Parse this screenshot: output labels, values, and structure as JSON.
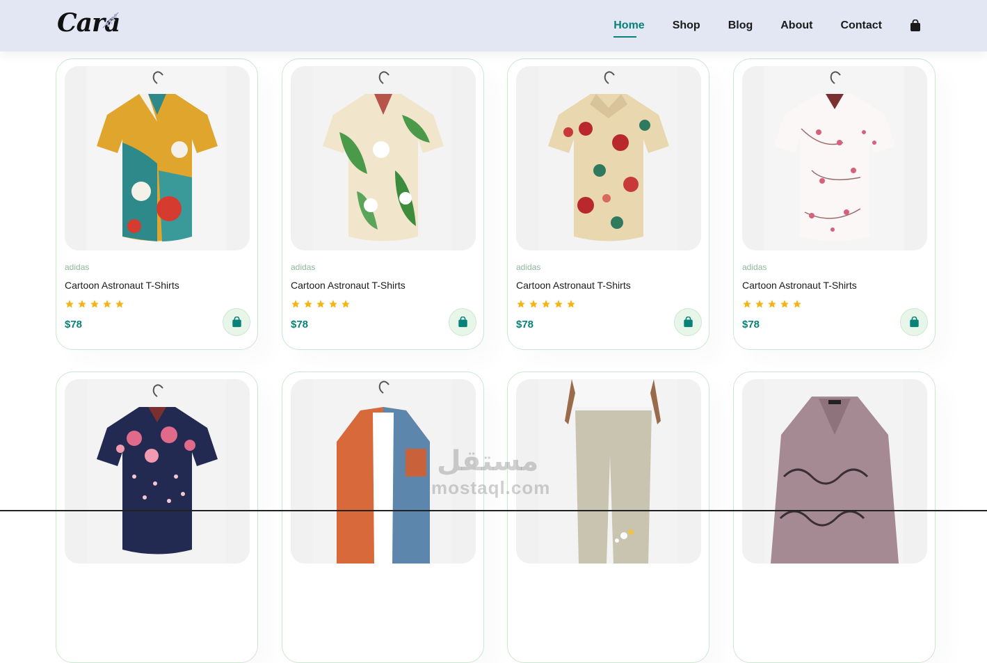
{
  "header": {
    "logo_text": "Cara",
    "nav": [
      {
        "label": "Home",
        "active": true
      },
      {
        "label": "Shop",
        "active": false
      },
      {
        "label": "Blog",
        "active": false
      },
      {
        "label": "About",
        "active": false
      },
      {
        "label": "Contact",
        "active": false
      }
    ],
    "cart_icon": "shopping-bag-icon"
  },
  "products": [
    {
      "brand": "adidas",
      "name": "Cartoon Astronaut T-Shirts",
      "price": "$78",
      "rating": 5,
      "image": "shirt-colorful-abstract"
    },
    {
      "brand": "adidas",
      "name": "Cartoon Astronaut T-Shirts",
      "price": "$78",
      "rating": 5,
      "image": "shirt-green-leaves"
    },
    {
      "brand": "adidas",
      "name": "Cartoon Astronaut T-Shirts",
      "price": "$78",
      "rating": 5,
      "image": "shirt-red-floral"
    },
    {
      "brand": "adidas",
      "name": "Cartoon Astronaut T-Shirts",
      "price": "$78",
      "rating": 5,
      "image": "shirt-pink-blossom"
    },
    {
      "brand": "",
      "name": "",
      "price": "",
      "rating": 0,
      "image": "shirt-navy-floral"
    },
    {
      "brand": "",
      "name": "",
      "price": "",
      "rating": 0,
      "image": "jacket-orange-blue"
    },
    {
      "brand": "",
      "name": "",
      "price": "",
      "rating": 0,
      "image": "pants-beige"
    },
    {
      "brand": "",
      "name": "",
      "price": "",
      "rating": 0,
      "image": "blouse-mauve-print"
    }
  ],
  "watermark": {
    "arabic": "مستقل",
    "latin": "mostaql.com"
  },
  "colors": {
    "accent": "#088178",
    "header_bg": "#e3e6f3",
    "star": "#f3b519",
    "card_border": "#cce7d0"
  }
}
